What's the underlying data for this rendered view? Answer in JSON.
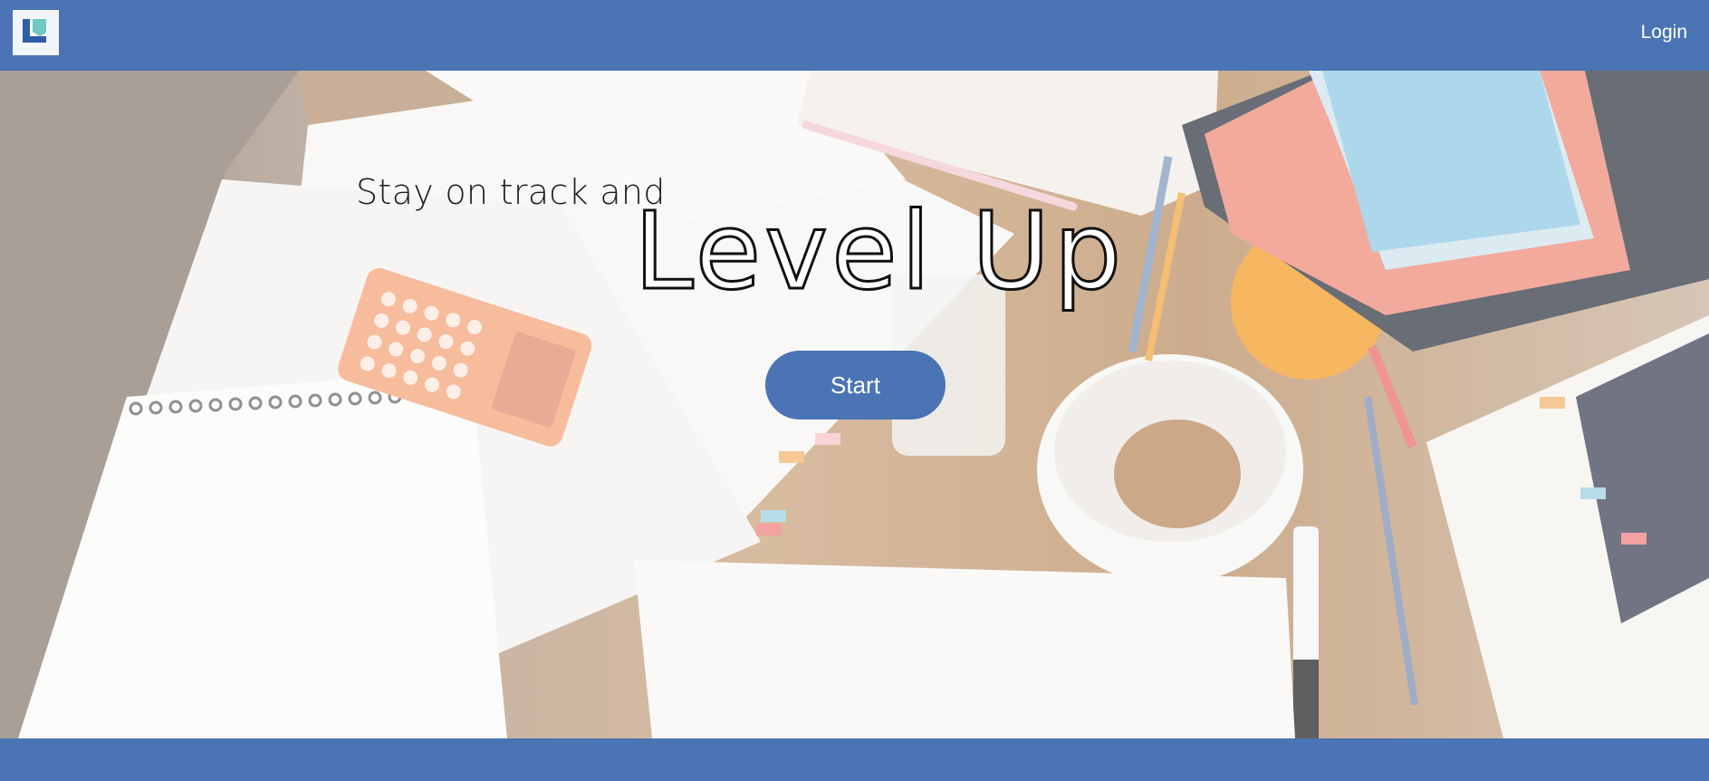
{
  "header": {
    "logo_letter": "L",
    "login_label": "Login"
  },
  "hero": {
    "tagline": "Stay on track and",
    "title": "Level Up",
    "start_label": "Start"
  },
  "colors": {
    "brand_blue": "#4a74b4",
    "text_dark": "#1b1b1b",
    "white": "#ffffff"
  }
}
